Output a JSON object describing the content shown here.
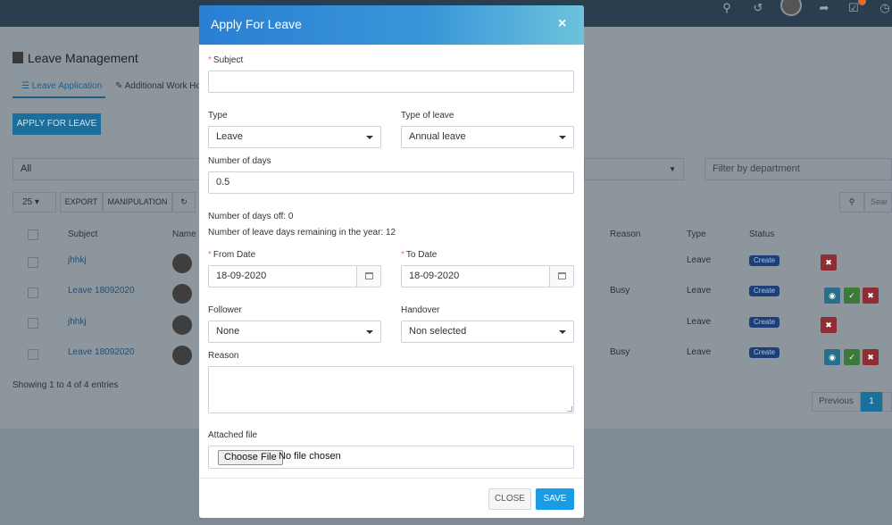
{
  "page": {
    "title": "Leave Management",
    "tabs": [
      {
        "label": "Leave Application"
      },
      {
        "label": "Additional Work Ho"
      }
    ],
    "apply_button": "APPLY FOR LEAVE",
    "filter_all": "All",
    "filter_department_placeholder": "Filter by department",
    "page_size": "25",
    "export": "EXPORT",
    "manipulation": "MANIPULATION",
    "search_placeholder": "Sear",
    "columns": {
      "subject": "Subject",
      "name": "Name",
      "reason": "Reason",
      "type": "Type",
      "status": "Status"
    },
    "rows": [
      {
        "subject": "jhhkj",
        "reason": "",
        "type": "Leave",
        "status": "Create"
      },
      {
        "subject": "Leave 18092020",
        "reason": "Busy",
        "type": "Leave",
        "status": "Create"
      },
      {
        "subject": "jhhkj",
        "reason": "",
        "type": "Leave",
        "status": "Create"
      },
      {
        "subject": "Leave 18092020",
        "reason": "Busy",
        "type": "Leave",
        "status": "Create"
      }
    ],
    "showing": "Showing 1 to 4 of 4 entries",
    "pagination": {
      "previous": "Previous",
      "current": "1"
    }
  },
  "modal": {
    "title": "Apply For Leave",
    "close_symbol": "×",
    "required_mark": "*",
    "subject_label": "Subject",
    "subject_value": "",
    "type_label": "Type",
    "type_value": "Leave",
    "type_of_leave_label": "Type of leave",
    "type_of_leave_value": "Annual leave",
    "days_label": "Number of days",
    "days_value": "0.5",
    "days_off_text": "Number of days off: 0",
    "remaining_text": "Number of leave days remaining in the year: 12",
    "from_date_label": "From Date",
    "from_date_value": "18-09-2020",
    "to_date_label": "To Date",
    "to_date_value": "18-09-2020",
    "follower_label": "Follower",
    "follower_value": "None",
    "handover_label": "Handover",
    "handover_value": "Non selected",
    "reason_label": "Reason",
    "reason_value": "",
    "attached_label": "Attached file",
    "choose_file": "Choose File",
    "no_file": "No file chosen",
    "close_button": "CLOSE",
    "save_button": "SAVE"
  },
  "colors": {
    "header_start": "#2a7fd3",
    "header_end": "#6cc3dc",
    "save": "#1a9be6",
    "status_badge": "#1d3f78",
    "required": "#e57373"
  }
}
